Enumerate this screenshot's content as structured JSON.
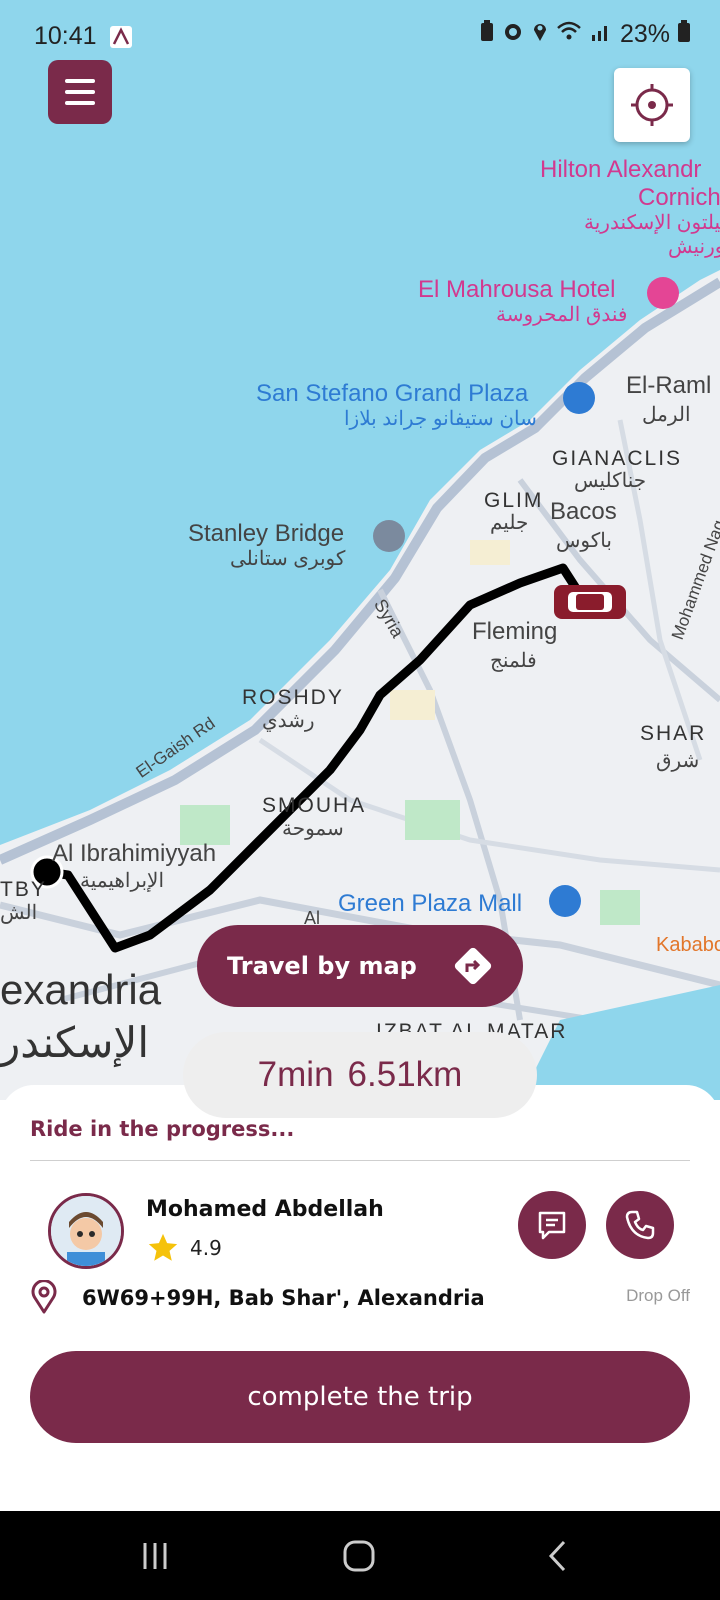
{
  "status": {
    "time": "10:41",
    "battery": "23%"
  },
  "map": {
    "labels": {
      "hilton_en": "Hilton Alexandr",
      "hilton_en2": "Cornich",
      "hilton_ar": "هيلتون الإسكندرية",
      "hilton_ar2": "كورنيش",
      "mahrousa_en": "El Mahrousa Hotel",
      "mahrousa_ar": "فندق المحروسة",
      "sanstefano_en": "San Stefano Grand Plaza",
      "sanstefano_ar": "سان ستيفانو جراند بلازا",
      "elraml_en": "El-Raml",
      "elraml_ar": "الرمل",
      "gianaclis_en": "GIANACLIS",
      "gianaclis_ar": "جناكليس",
      "glim_en": "GLIM",
      "glim_ar": "جليم",
      "bacos_en": "Bacos",
      "bacos_ar": "باكوس",
      "stanley_en": "Stanley Bridge",
      "stanley_ar": "كوبرى ستانلى",
      "syria": "Syria",
      "fleming_en": "Fleming",
      "fleming_ar": "فلمنج",
      "mohammed_nag": "Mohammed Nag",
      "roshdy_en": "ROSHDY",
      "roshdy_ar": "رشدي",
      "elgaish": "El-Gaish Rd",
      "shar_en": "SHAR",
      "shar_ar": "شرق",
      "smouha_en": "SMOUHA",
      "smouha_ar": "سموحة",
      "ibrahimiyyah_en": "Al Ibrahimiyyah",
      "ibrahimiyyah_ar": "الإبراهيمية",
      "tby_en": "TBY",
      "tby_ar": "الش",
      "greenplaza": "Green Plaza Mall",
      "kababo": "Kababo",
      "alexandria_en": "exandria",
      "alexandria_ar": "الإسكندر",
      "izbat": "IZBAT AL MATAR",
      "al_short": "Al"
    },
    "colors": {
      "water": "#8fd6ec",
      "land": "#eef0f3",
      "route": "#000000",
      "accent": "#7a2a4a"
    }
  },
  "travel_button": {
    "label": "Travel by map",
    "icon": "directions-icon"
  },
  "eta": {
    "time": "7min",
    "distance": "6.51km"
  },
  "sheet": {
    "title": "Ride in the progress...",
    "driver": {
      "name": "Mohamed Abdellah",
      "rating": "4.9"
    },
    "address": "6W69+99H, Bab Shar', Alexandria",
    "address_tag": "Drop Off",
    "complete_label": "complete the trip"
  }
}
